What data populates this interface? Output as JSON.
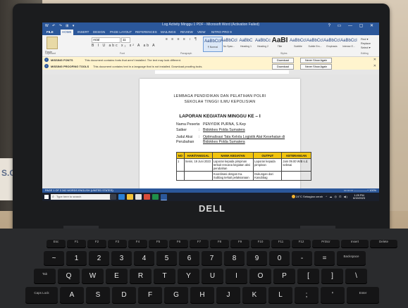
{
  "word": {
    "window_title": "Log Activity Minggu 1 PDF - Microsoft Word (Activation Failed)",
    "qat": "W ↶ ↷ ⊞ ▾",
    "window_controls": "? ▭ — ▢ ✕",
    "tabs": [
      "FILE",
      "HOME",
      "INSERT",
      "DESIGN",
      "PAGE LAYOUT",
      "REFERENCES",
      "MAILINGS",
      "REVIEW",
      "VIEW",
      "NITRO PRO 9"
    ],
    "ribbon": {
      "clipboard_label": "Paste",
      "font_name": "Arial",
      "font_size": "11",
      "format_buttons": "B I U abc x₂ x² A ab A",
      "paragraph_buttons": "≡ ≡ ≡ ≡ ↕ ¶",
      "styles": [
        {
          "sample": "AaBbCcI",
          "name": "¶ Normal"
        },
        {
          "sample": "AaBbCcI",
          "name": "No Spac..."
        },
        {
          "sample": "AaBbC",
          "name": "Heading 1"
        },
        {
          "sample": "AaBbCc",
          "name": "Heading 2"
        },
        {
          "sample": "AaBI",
          "name": "Title"
        },
        {
          "sample": "AaBbCcI",
          "name": "Subtitle"
        },
        {
          "sample": "AaBbCcI",
          "name": "Subtle Em..."
        },
        {
          "sample": "AaBbCcI",
          "name": "Emphasis"
        },
        {
          "sample": "AaBbCcI",
          "name": "Intense E..."
        }
      ],
      "editing": [
        "Find ▾",
        "Replace",
        "Select ▾"
      ],
      "group_labels": [
        "Clipboard",
        "Font",
        "Paragraph",
        "Styles",
        "Editing"
      ]
    },
    "warnings": [
      {
        "label": "MISSING FONTS",
        "message": "This document contains fonts that aren't installed. The text may look different.",
        "button1": "Download",
        "button2": "Never Show Again"
      },
      {
        "label": "MISSING PROOFING TOOLS",
        "message": "This document contains text in a language that is not installed. Download proofing tools.",
        "button1": "Download",
        "button2": "Never Show Again"
      }
    ],
    "document": {
      "institution_line1": "LEMBAGA PENDIDIKAN DAN PELATIHAN POLRI",
      "institution_line2": "SEKOLAH TINGGI ILMU KEPOLISIAN",
      "title": "LAPORAN KEGIATAN MINGGU KE – I",
      "fields": [
        {
          "label": "Nama Peserta",
          "value": "PENYIDIK PURNA, S.Kep"
        },
        {
          "label": "Satker",
          "value": "Bidokkes Polda Sumatera"
        },
        {
          "label": "Judul Aksi",
          "value": "Optimalisasi Tata Kelola Logistik Alat Kesehatan di"
        },
        {
          "label": "Perubahan",
          "value": "Bidokkes Polda Sumatera"
        }
      ],
      "table": {
        "headers": [
          "NO",
          "HARI/TANGGAL",
          "NAMA KEGIATAN",
          "OUTPUT",
          "KETERANGAN"
        ],
        "rows": [
          [
            "1",
            "Senin, 19 Juni 2023",
            "Laporan kepada pimpinan terkait rencana kegiatan aksi perubahan",
            "Laporan kepada pimpinan",
            "Jam 09.00 WIB s.d. selesai"
          ],
          [
            "",
            "",
            "Koordinasi dengan Ka. Subbag terkait pelaksanaan",
            "Dukungan dari Kasubbag",
            ""
          ]
        ]
      }
    },
    "status": {
      "left": "PAGE 1 OF 3    342 WORDS    ENGLISH (UNITED STATES)",
      "right": "▭ ▭ ▭ —————+ 100%"
    }
  },
  "taskbar": {
    "search_placeholder": "Type here to search",
    "weather": "24°C Sebagian cerah",
    "time": "1:29 PM",
    "date": "6/19/2023",
    "tray": "^ ☁ ◎ ⊡ ◀)"
  },
  "laptop": {
    "brand": "DELL"
  },
  "background": {
    "poster_text": "S.O.IC"
  },
  "keyboard": {
    "row_fn": [
      "Esc",
      "F1",
      "F2",
      "F3",
      "F4",
      "F5",
      "F6",
      "F7",
      "F8",
      "F9",
      "F10",
      "F11",
      "F12",
      "PrtScr",
      "Insert",
      "Delete"
    ],
    "row_num": [
      "~",
      "1",
      "2",
      "3",
      "4",
      "5",
      "6",
      "7",
      "8",
      "9",
      "0",
      "-",
      "=",
      "Backspace"
    ],
    "row_q": [
      "Tab",
      "Q",
      "W",
      "E",
      "R",
      "T",
      "Y",
      "U",
      "I",
      "O",
      "P",
      "[",
      "]",
      "\\"
    ],
    "row_a": [
      "Caps Lock",
      "A",
      "S",
      "D",
      "F",
      "G",
      "H",
      "J",
      "K",
      "L",
      ";",
      "'",
      "Enter"
    ]
  }
}
